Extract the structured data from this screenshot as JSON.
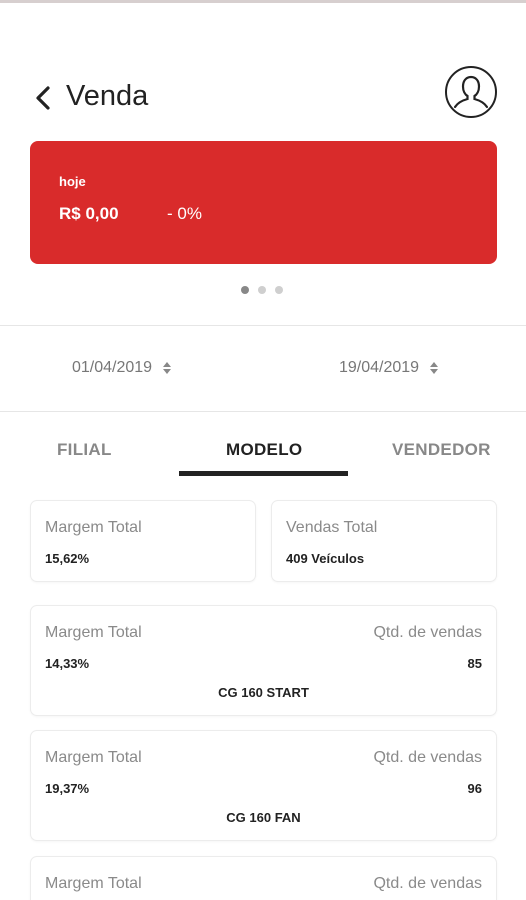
{
  "header": {
    "title": "Venda",
    "back_icon": "chevron-left-icon",
    "profile_icon": "user-avatar-icon"
  },
  "summary_card": {
    "label": "hoje",
    "value": "R$ 0,00",
    "change": "- 0%",
    "color": "#d92b2b"
  },
  "carousel": {
    "pages": 3,
    "active": 1
  },
  "date_range": {
    "start": "01/04/2019",
    "end": "19/04/2019"
  },
  "tabs": [
    {
      "label": "FILIAL"
    },
    {
      "label": "MODELO"
    },
    {
      "label": "VENDEDOR"
    }
  ],
  "active_tab": "MODELO",
  "totals": {
    "margin_label": "Margem Total",
    "margin_value": "15,62%",
    "sales_label": "Vendas Total",
    "sales_value": "409 Veículos"
  },
  "models": [
    {
      "margin_label": "Margem Total",
      "margin": "14,33%",
      "qty_label": "Qtd. de vendas",
      "qty": "85",
      "name": "CG 160 START"
    },
    {
      "margin_label": "Margem Total",
      "margin": "19,37%",
      "qty_label": "Qtd. de vendas",
      "qty": "96",
      "name": "CG 160 FAN"
    },
    {
      "margin_label": "Margem Total",
      "qty_label": "Qtd. de vendas"
    }
  ]
}
